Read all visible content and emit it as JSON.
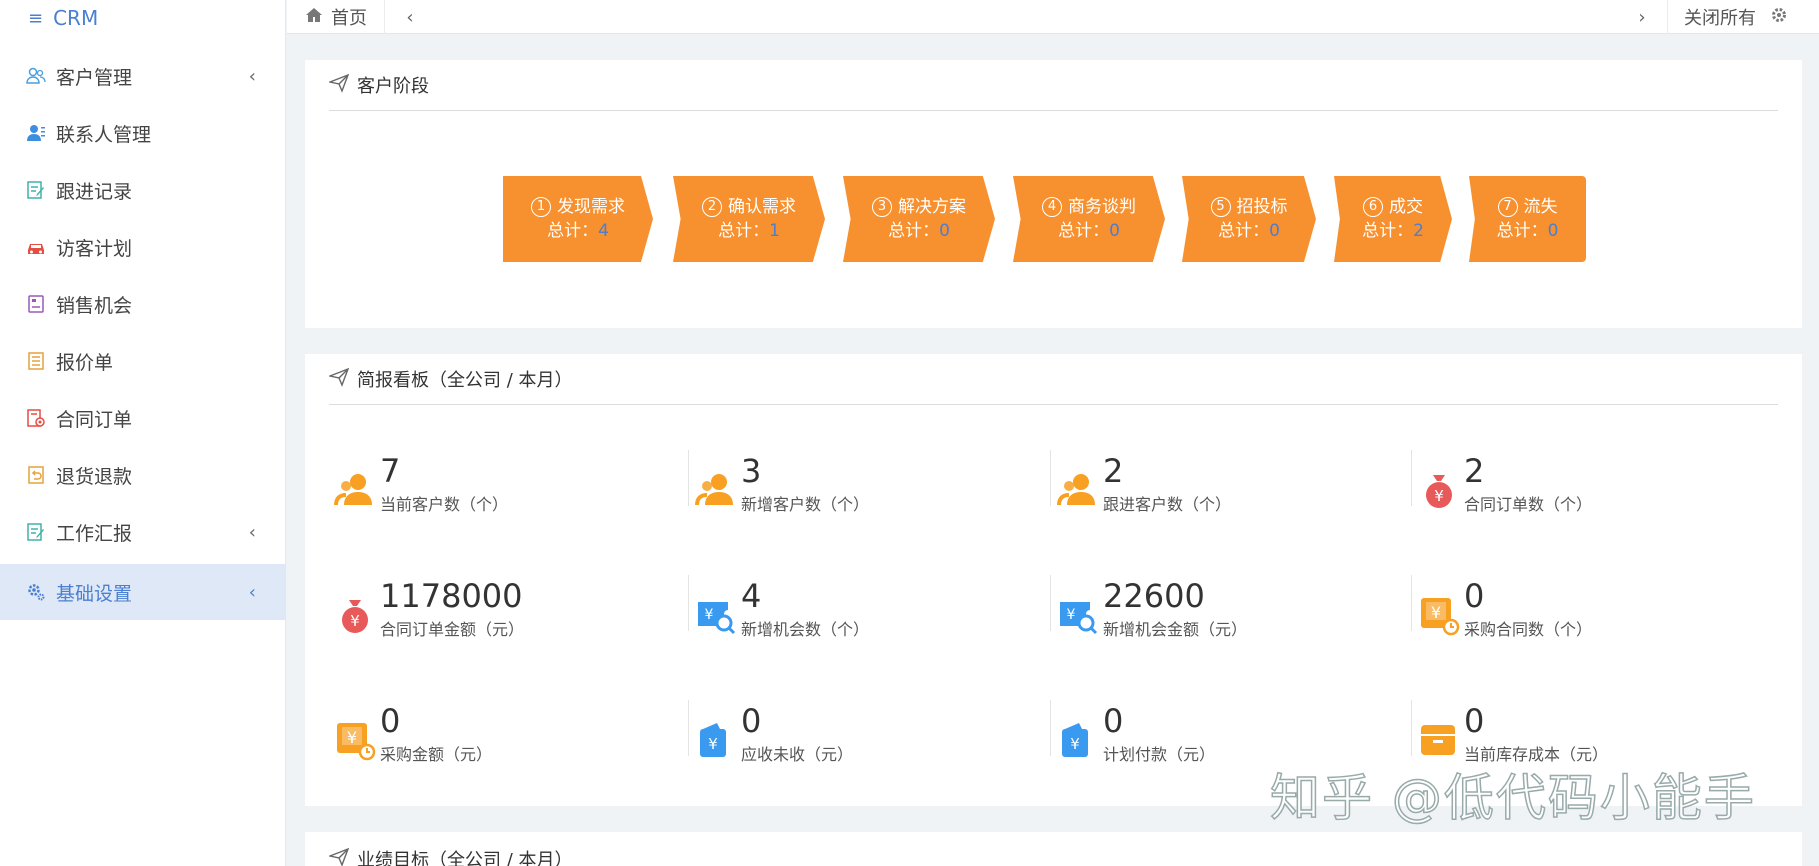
{
  "app": {
    "title": "CRM"
  },
  "sidebar": {
    "items": [
      {
        "label": "客户管理",
        "icon": "users-icon",
        "color": "#4a9fe0",
        "has_submenu": true
      },
      {
        "label": "联系人管理",
        "icon": "contact-icon",
        "color": "#3e8ee0",
        "has_submenu": false
      },
      {
        "label": "跟进记录",
        "icon": "edit-record-icon",
        "color": "#3fb3a9",
        "has_submenu": false
      },
      {
        "label": "访客计划",
        "icon": "car-icon",
        "color": "#e54d42",
        "has_submenu": false
      },
      {
        "label": "销售机会",
        "icon": "clipboard-icon",
        "color": "#9b59b6",
        "has_submenu": false
      },
      {
        "label": "报价单",
        "icon": "list-icon",
        "color": "#e6a23c",
        "has_submenu": false
      },
      {
        "label": "合同订单",
        "icon": "contract-icon",
        "color": "#e54d42",
        "has_submenu": false
      },
      {
        "label": "退货退款",
        "icon": "return-icon",
        "color": "#e6a23c",
        "has_submenu": false
      },
      {
        "label": "工作汇报",
        "icon": "report-icon",
        "color": "#3fb3a9",
        "has_submenu": true
      },
      {
        "label": "基础设置",
        "icon": "settings-icon",
        "color": "#4a7fd1",
        "has_submenu": true,
        "active": true
      }
    ]
  },
  "topbar": {
    "home_label": "首页",
    "close_all_label": "关闭所有"
  },
  "stage_panel": {
    "title": "客户阶段",
    "count_label": "总计：",
    "stages": [
      {
        "num": "1",
        "name": "发现需求",
        "count": "4"
      },
      {
        "num": "2",
        "name": "确认需求",
        "count": "1"
      },
      {
        "num": "3",
        "name": "解决方案",
        "count": "0"
      },
      {
        "num": "4",
        "name": "商务谈判",
        "count": "0"
      },
      {
        "num": "5",
        "name": "招投标",
        "count": "0"
      },
      {
        "num": "6",
        "name": "成交",
        "count": "2"
      },
      {
        "num": "7",
        "name": "流失",
        "count": "0"
      }
    ]
  },
  "brief_panel": {
    "title": "简报看板（全公司 / 本月）",
    "stats": [
      {
        "value": "7",
        "label": "当前客户数（个）",
        "icon": "customer-icon"
      },
      {
        "value": "3",
        "label": "新增客户数（个）",
        "icon": "customer-icon"
      },
      {
        "value": "2",
        "label": "跟进客户数（个）",
        "icon": "customer-icon"
      },
      {
        "value": "2",
        "label": "合同订单数（个）",
        "icon": "money-bag-icon"
      },
      {
        "value": "1178000",
        "label": "合同订单金额（元）",
        "icon": "money-bag-icon"
      },
      {
        "value": "4",
        "label": "新增机会数（个）",
        "icon": "opportunity-icon"
      },
      {
        "value": "22600",
        "label": "新增机会金额（元）",
        "icon": "opportunity-icon"
      },
      {
        "value": "0",
        "label": "采购合同数（个）",
        "icon": "purchase-icon"
      },
      {
        "value": "0",
        "label": "采购金额（元）",
        "icon": "purchase-icon"
      },
      {
        "value": "0",
        "label": "应收未收（元）",
        "icon": "wallet-icon"
      },
      {
        "value": "0",
        "label": "计划付款（元）",
        "icon": "wallet-icon"
      },
      {
        "value": "0",
        "label": "当前库存成本（元）",
        "icon": "inventory-icon"
      }
    ]
  },
  "target_panel": {
    "title": "业绩目标（全公司 / 本月）"
  },
  "watermark": "知乎 @低代码小能手",
  "colors": {
    "accent": "#4a7fd1",
    "stage_orange": "#f7902e",
    "stat_orange": "#f7a021",
    "stat_red": "#e85a5a",
    "stat_blue": "#3a9af0"
  }
}
